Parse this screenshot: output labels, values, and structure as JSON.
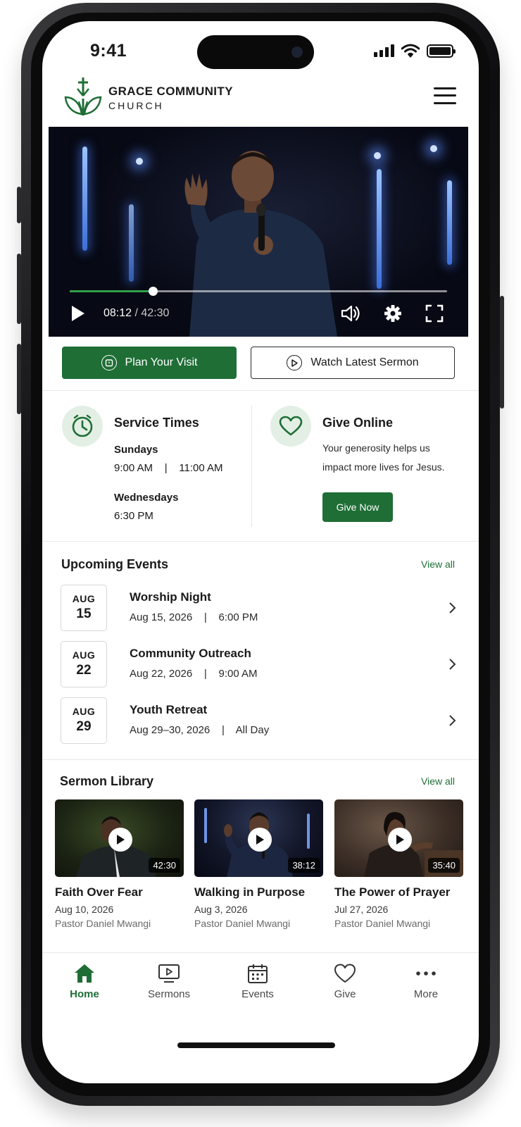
{
  "status_bar": {
    "time": "9:41"
  },
  "header": {
    "brand_line1": "GRACE COMMUNITY",
    "brand_line2": "CHURCH",
    "logo_icon": "cross-leaf-icon",
    "menu_icon": "hamburger-menu-icon"
  },
  "video": {
    "current_time": "08:12",
    "separator": " / ",
    "duration": "42:30",
    "progress": 0.22
  },
  "cta": {
    "plan_visit": "Plan Your Visit",
    "watch_sermon": "Watch Latest Sermon"
  },
  "service_times": {
    "title": "Service Times",
    "day1": "Sundays",
    "day1_times": "9:00 AM    |    11:00 AM",
    "day2": "Wednesdays",
    "day2_times": "6:30 PM"
  },
  "give": {
    "title": "Give Online",
    "text_line1": "Your generosity helps us",
    "text_line2": "impact more lives for Jesus.",
    "button": "Give Now"
  },
  "events": {
    "title": "Upcoming Events",
    "view_all": "View all",
    "items": [
      {
        "month": "AUG",
        "day": "15",
        "title": "Worship Night",
        "meta": "Aug 15, 2026    |    6:00 PM"
      },
      {
        "month": "AUG",
        "day": "22",
        "title": "Community Outreach",
        "meta": "Aug 22, 2026    |    9:00 AM"
      },
      {
        "month": "AUG",
        "day": "29",
        "title": "Youth Retreat",
        "meta": "Aug 29–30, 2026    |    All Day"
      }
    ]
  },
  "sermons": {
    "title": "Sermon Library",
    "view_all": "View all",
    "items": [
      {
        "title": "Faith Over Fear",
        "date": "Aug 10, 2026",
        "pastor": "Pastor Daniel Mwangi",
        "duration": "42:30"
      },
      {
        "title": "Walking in Purpose",
        "date": "Aug 3, 2026",
        "pastor": "Pastor Daniel Mwangi",
        "duration": "38:12"
      },
      {
        "title": "The Power of Prayer",
        "date": "Jul 27, 2026",
        "pastor": "Pastor Daniel Mwangi",
        "duration": "35:40"
      }
    ]
  },
  "tabbar": {
    "items": [
      {
        "label": "Home",
        "icon": "home-icon",
        "active": true
      },
      {
        "label": "Sermons",
        "icon": "video-play-icon",
        "active": false
      },
      {
        "label": "Events",
        "icon": "calendar-icon",
        "active": false
      },
      {
        "label": "Give",
        "icon": "heart-icon",
        "active": false
      },
      {
        "label": "More",
        "icon": "more-dots-icon",
        "active": false
      }
    ]
  },
  "colors": {
    "brand_green": "#1f6e36",
    "light_green": "#e3efe5",
    "progress_green": "#33a04a"
  }
}
